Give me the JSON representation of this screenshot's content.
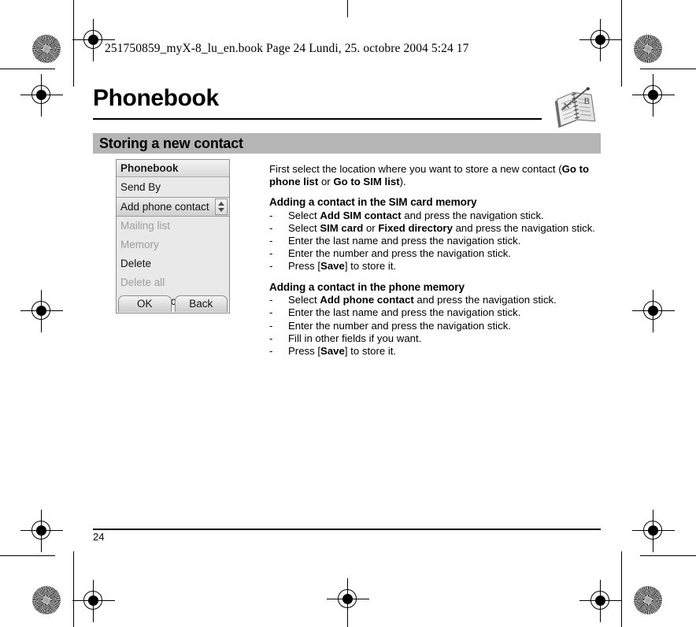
{
  "document": {
    "file_header": "251750859_myX-8_lu_en.book  Page 24  Lundi, 25. octobre 2004  5:24 17",
    "title": "Phonebook",
    "page_number": "24",
    "book_icon": "address-book-icon"
  },
  "section": {
    "banner_label": "Storing a new contact",
    "banner_color": "#b5b5b5"
  },
  "phone_screenshot": {
    "title": "Phonebook",
    "items": [
      {
        "label": "Send By",
        "state": "enabled"
      },
      {
        "label": "Add phone contact",
        "state": "selected"
      },
      {
        "label": "Mailing list",
        "state": "disabled"
      },
      {
        "label": "Memory",
        "state": "disabled"
      },
      {
        "label": "Delete",
        "state": "enabled"
      },
      {
        "label": "Delete all",
        "state": "disabled"
      },
      {
        "label": "Set as my card",
        "state": "enabled"
      }
    ],
    "spinner": {
      "up_icon": "scroll-up-arrow-icon",
      "down_icon": "scroll-down-arrow-icon"
    },
    "softkeys": {
      "left": "OK",
      "right": "Back"
    }
  },
  "body": {
    "intro": {
      "part1": "First select the location where you want to store a new contact (",
      "bold1": "Go to phone list",
      "mid": " or ",
      "bold2": "Go to SIM list",
      "part2": ")."
    },
    "sim_section": {
      "heading": "Adding a contact in the SIM card memory",
      "dash": "-",
      "steps": [
        {
          "pre": "Select ",
          "bold": "Add SIM contact",
          "post": " and press the navigation stick."
        },
        {
          "pre": "Select ",
          "bold": "SIM card",
          "mid": " or ",
          "bold2": "Fixed directory",
          "post": " and press the navigation stick."
        },
        {
          "pre": "Enter the last name and press the navigation stick.",
          "bold": "",
          "post": ""
        },
        {
          "pre": "Enter the number and press the navigation stick.",
          "bold": "",
          "post": ""
        },
        {
          "pre": "Press [",
          "bold": "Save",
          "post": "] to store it."
        }
      ]
    },
    "phone_section": {
      "heading": "Adding a contact in the phone memory",
      "dash": "-",
      "steps": [
        {
          "pre": "Select ",
          "bold": "Add phone contact",
          "post": " and press the navigation stick."
        },
        {
          "pre": "Enter the last name and press the navigation stick.",
          "bold": "",
          "post": ""
        },
        {
          "pre": "Enter the number and press the navigation stick.",
          "bold": "",
          "post": ""
        },
        {
          "pre": "Fill in other fields if you want.",
          "bold": "",
          "post": ""
        },
        {
          "pre": "Press [",
          "bold": "Save",
          "post": "] to store it."
        }
      ]
    }
  },
  "print_marks": {
    "registration_icon": "registration-target-icon",
    "density_icon": "print-density-starburst-icon"
  }
}
